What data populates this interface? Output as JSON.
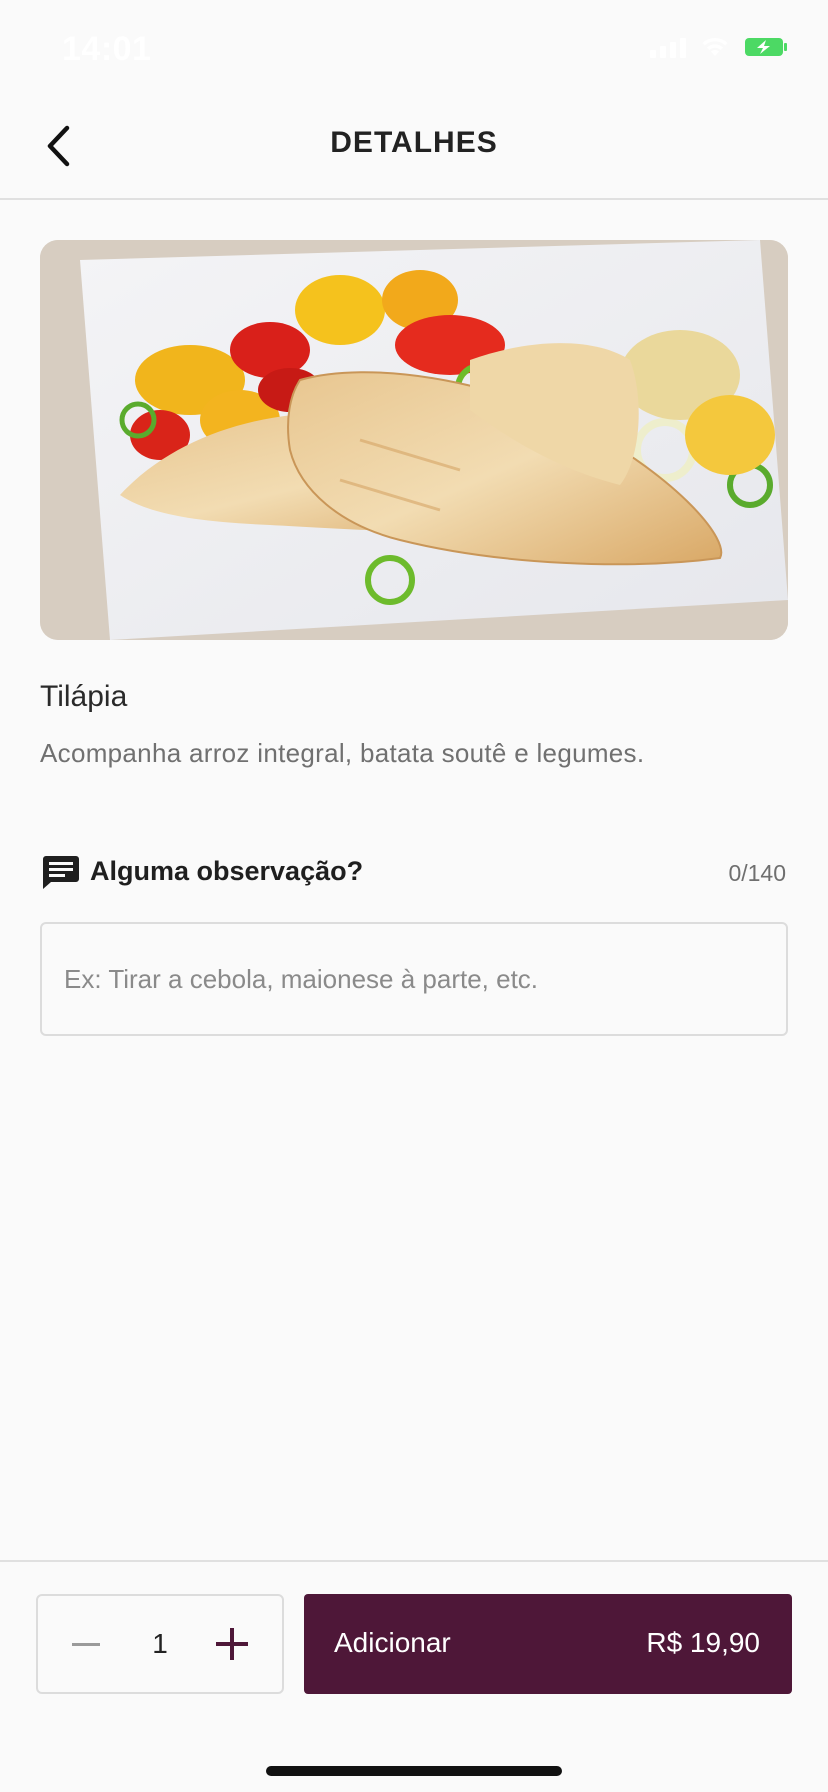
{
  "status_bar": {
    "time": "14:01",
    "icons": [
      "signal-icon",
      "wifi-icon",
      "battery-charging-icon"
    ],
    "battery_color": "#4cd964"
  },
  "header": {
    "title": "DETALHES",
    "back_icon": "chevron-left-icon"
  },
  "product": {
    "image_alt": "Tilápia",
    "name": "Tilápia",
    "description": "Acompanha arroz integral, batata soutê e legumes."
  },
  "observation": {
    "icon": "comment-icon",
    "label": "Alguma observação?",
    "counter": "0/140",
    "value": "",
    "placeholder": "Ex: Tirar a cebola, maionese à parte, etc."
  },
  "footer": {
    "quantity": "1",
    "minus_icon": "minus-icon",
    "plus_icon": "plus-icon",
    "add_label": "Adicionar",
    "price": "R$ 19,90",
    "accent_color": "#4e1738"
  }
}
